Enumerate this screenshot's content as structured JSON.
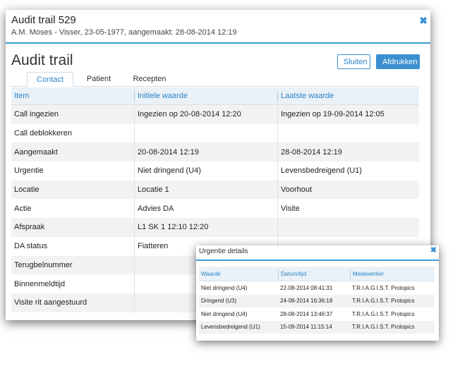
{
  "dialog": {
    "title": "Audit trail 529",
    "subtitle": "A.M. Moses - Visser, 23-05-1977, aangemaakt: 28-08-2014 12:19",
    "close_glyph": "✖",
    "close_icon": "close-icon"
  },
  "page": {
    "title": "Audit trail",
    "close_button": "Sluiten",
    "print_button": "Afdrukken"
  },
  "tabs": [
    {
      "label": "Contact",
      "active": true
    },
    {
      "label": "Patient",
      "active": false
    },
    {
      "label": "Recepten",
      "active": false
    }
  ],
  "grid": {
    "columns": [
      "Item",
      "Initiele waarde",
      "Laatste waarde"
    ],
    "rows": [
      [
        "Call ingezien",
        "Ingezien op 20-08-2014 12:20",
        "Ingezien op 19-09-2014 12:05"
      ],
      [
        "Call deblokkeren",
        "",
        ""
      ],
      [
        "Aangemaakt",
        "20-08-2014 12:19",
        "28-08-2014 12:19"
      ],
      [
        "Urgentie",
        "Niet dringend (U4)",
        "Levensbedreigend (U1)"
      ],
      [
        "Locatie",
        "Locatie 1",
        "Voorhout"
      ],
      [
        "Actie",
        "Advies DA",
        "Visite"
      ],
      [
        "Afspraak",
        "L1 SK 1 12:10 12:20",
        ""
      ],
      [
        "DA status",
        "Fiatteren",
        ""
      ],
      [
        "Terugbelnummer",
        "",
        ""
      ],
      [
        "Binnenmeldtijd",
        "",
        ""
      ],
      [
        "Visite rit aangestuurd",
        "",
        ""
      ]
    ]
  },
  "urgentie": {
    "title": "Urgentie details",
    "close_glyph": "✖",
    "columns": [
      "Waarde",
      "Datum/tijd",
      "Medewerker"
    ],
    "rows": [
      [
        "Niet dringend (U4)",
        "22-08-2014 08:41:31",
        "T.R.I.A.G.I.S.T. Protopics"
      ],
      [
        "Dringend (U3)",
        "24-08-2014 16:36:18",
        "T.R.I.A.G.I.S.T. Protopics"
      ],
      [
        "Niet dringend (U4)",
        "28-08-2014 13:46:37",
        "T.R.I.A.G.I.S.T. Protopics"
      ],
      [
        "Levensbedreigend (U1)",
        "15-09-2014 11:15:14",
        "T.R.I.A.G.I.S.T. Protopics"
      ]
    ]
  },
  "colors": {
    "accent": "#3a8fd0",
    "header_bg": "#eaf1f7",
    "alt_row": "#f2f2f2"
  }
}
